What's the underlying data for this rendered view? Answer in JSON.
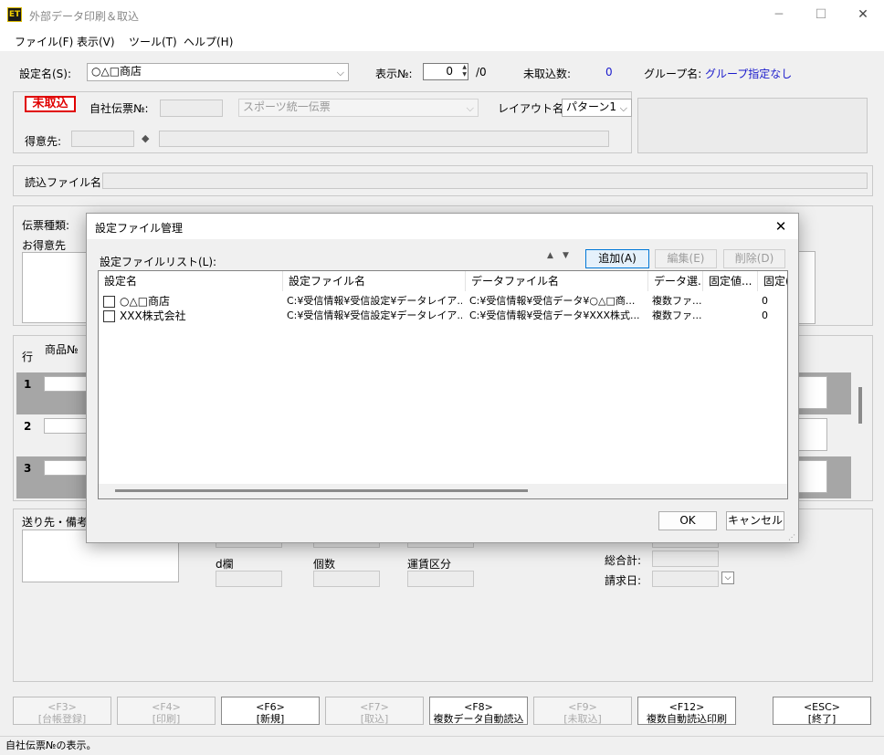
{
  "window": {
    "title": "外部データ印刷＆取込",
    "app_icon_text": "ET",
    "controls": {
      "minimize": "─",
      "maximize": "☐",
      "close": "✕"
    }
  },
  "menu": [
    "ファイル(F)",
    "表示(V)",
    "ツール(T)",
    "ヘルプ(H)"
  ],
  "top": {
    "setting_name_label": "設定名(S):",
    "setting_name_value": "○△□商店",
    "display_no_label": "表示№:",
    "display_no_value": "0",
    "display_no_total": "/0",
    "unimported_label": "未取込数:",
    "unimported_value": "0",
    "group_label": "グループ名:",
    "group_value": "グループ指定なし"
  },
  "header_group": {
    "status_badge": "未取込",
    "own_slip_label": "自社伝票№:",
    "slip_type_value": "スポーツ統一伝票",
    "layout_label": "レイアウト名:",
    "layout_value": "パターン1",
    "customer_label": "得意先:",
    "diamond": "◆"
  },
  "read_file_label": "読込ファイル名:",
  "slip_section": {
    "slip_type_label": "伝票種類:",
    "customer_label": "お得意先",
    "row_label": "行",
    "product_no_label": "商品№",
    "rows": [
      "1",
      "2",
      "3"
    ]
  },
  "footer_section": {
    "notes_label": "送り先・備考",
    "d_col_label": "d欄",
    "qty_label": "個数",
    "freight_label": "運賃区分",
    "grand_total_label": "総合計:",
    "billing_date_label": "請求日:"
  },
  "fkeys": [
    {
      "key": "<F3>",
      "label": "[台帳登録]",
      "enabled": false
    },
    {
      "key": "<F4>",
      "label": "[印刷]",
      "enabled": false
    },
    {
      "key": "<F6>",
      "label": "[新規]",
      "enabled": true
    },
    {
      "key": "<F7>",
      "label": "[取込]",
      "enabled": false
    },
    {
      "key": "<F8>",
      "label": "複数データ自動読込",
      "enabled": true
    },
    {
      "key": "<F9>",
      "label": "[未取込]",
      "enabled": false
    },
    {
      "key": "<F12>",
      "label": "複数自動読込印刷",
      "enabled": true
    },
    {
      "key": "<ESC>",
      "label": "[終了]",
      "enabled": true
    }
  ],
  "status_text": "自社伝票№の表示。",
  "dialog": {
    "title": "設定ファイル管理",
    "close": "✕",
    "list_label": "設定ファイルリスト(L):",
    "up_arrow": "▲",
    "down_arrow": "▼",
    "add_button": "追加(A)",
    "edit_button": "編集(E)",
    "delete_button": "削除(D)",
    "columns": [
      "設定名",
      "設定ファイル名",
      "データファイル名",
      "データ選...",
      "固定値...",
      "固定("
    ],
    "rows": [
      [
        "○△□商店",
        "C:¥受信情報¥受信設定¥データレイア...",
        "C:¥受信情報¥受信データ¥○△□商...",
        "複数ファ...",
        "",
        "0"
      ],
      [
        "XXX株式会社",
        "C:¥受信情報¥受信設定¥データレイア...",
        "C:¥受信情報¥受信データ¥XXX株式...",
        "複数ファ...",
        "",
        "0"
      ]
    ],
    "ok_button": "OK",
    "cancel_button": "キャンセル"
  },
  "colors": {
    "accent": "#0078d7",
    "badge_red": "#e00000",
    "value_blue": "#1a1acc"
  }
}
